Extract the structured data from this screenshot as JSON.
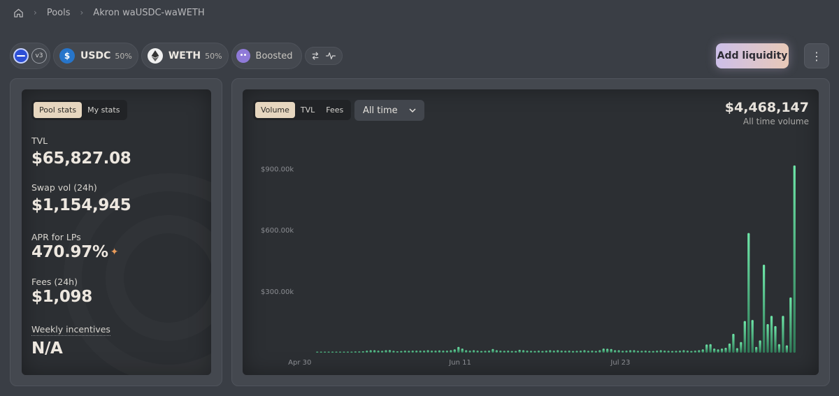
{
  "breadcrumb": {
    "items": [
      "Pools",
      "Akron waUSDC-waWETH"
    ]
  },
  "header": {
    "version": "v3",
    "tokens": [
      {
        "symbol": "USDC",
        "weight": "50%"
      },
      {
        "symbol": "WETH",
        "weight": "50%"
      }
    ],
    "boosted_label": "Boosted",
    "add_liquidity_label": "Add liquidity",
    "more_label": "⋮"
  },
  "stats": {
    "tabs": [
      "Pool stats",
      "My stats"
    ],
    "active_tab": "Pool stats",
    "tvl_label": "TVL",
    "tvl_value": "$65,827.08",
    "swap_vol_label": "Swap vol (24h)",
    "swap_vol_value": "$1,154,945",
    "apr_label": "APR for LPs",
    "apr_value": "470.97%",
    "fees_label": "Fees (24h)",
    "fees_value": "$1,098",
    "incentives_label": "Weekly incentives",
    "incentives_value": "N/A"
  },
  "chart_panel": {
    "tabs": [
      "Volume",
      "TVL",
      "Fees"
    ],
    "active_tab": "Volume",
    "range": "All time",
    "total_value": "$4,468,147",
    "total_label": "All time volume"
  },
  "colors": {
    "accent": "#e6d6bf",
    "bar_top": "#6ee6a8",
    "bar_bottom": "#2f7a57"
  },
  "chart_data": {
    "type": "bar",
    "ylim": [
      0,
      1150000
    ],
    "yticks": [
      300000,
      600000,
      900000
    ],
    "ytick_labels": [
      "$300.00k",
      "$600.00k",
      "$900.00k"
    ],
    "xtick_labels": [
      "Apr 30",
      "Jun 11",
      "Jul 23"
    ],
    "xtick_indices": [
      0,
      42,
      84
    ],
    "values": [
      3000,
      3000,
      3000,
      4000,
      3000,
      3000,
      3000,
      4000,
      4000,
      4000,
      6000,
      6000,
      7000,
      10000,
      12000,
      12000,
      10000,
      9000,
      12000,
      13000,
      9000,
      7000,
      8000,
      10000,
      9000,
      10000,
      10000,
      10000,
      10000,
      12000,
      10000,
      10000,
      11000,
      10000,
      10000,
      12000,
      16000,
      28000,
      20000,
      12000,
      10000,
      12000,
      10000,
      8000,
      9000,
      10000,
      18000,
      12000,
      10000,
      9000,
      10000,
      8000,
      8000,
      14000,
      12000,
      10000,
      9000,
      8000,
      10000,
      8000,
      10000,
      12000,
      10000,
      12000,
      10000,
      9000,
      10000,
      8000,
      9000,
      10000,
      12000,
      9000,
      10000,
      8000,
      12000,
      20000,
      19000,
      18000,
      12000,
      12000,
      9000,
      10000,
      12000,
      12000,
      9000,
      9000,
      10000,
      8000,
      8000,
      10000,
      12000,
      10000,
      9000,
      8000,
      9000,
      10000,
      12000,
      10000,
      8000,
      10000,
      12000,
      16000,
      40000,
      42000,
      20000,
      16000,
      20000,
      24000,
      45000,
      92000,
      22000,
      52000,
      155000,
      585000,
      160000,
      28000,
      60000,
      430000,
      140000,
      180000,
      130000,
      42000,
      180000,
      36000,
      270000,
      915000
    ]
  }
}
